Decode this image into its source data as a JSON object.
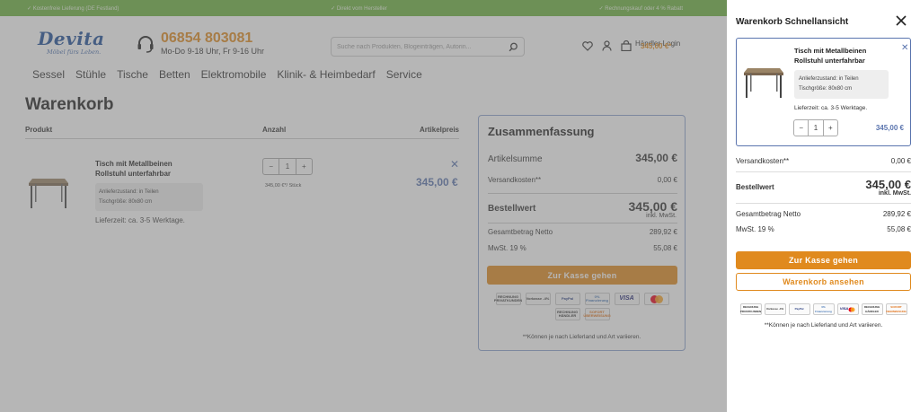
{
  "topbar": {
    "left": "✓ Kostenfreie Lieferung (DE Festland)",
    "center": "✓ Direkt vom Hersteller",
    "right": "✓ Rechnungskauf oder 4 % Rabatt"
  },
  "header": {
    "logo_name": "Devita",
    "logo_slogan": "Möbel fürs Leben.",
    "phone_number": "06854 803081",
    "phone_hours": "Mo-Do 9-18 Uhr, Fr 9-16 Uhr",
    "search_placeholder": "Suche nach Produkten, Blogeinträgen, Autorin...",
    "haendler_login": "Händler-Login",
    "cart_total": "345,00 €*"
  },
  "nav": [
    "Sessel",
    "Stühle",
    "Tische",
    "Betten",
    "Elektromobile",
    "Klinik- & Heimbedarf",
    "Service"
  ],
  "cart": {
    "title": "Warenkorb",
    "col_product": "Produkt",
    "col_qty": "Anzahl",
    "col_price": "Artikelpreis",
    "item": {
      "name": "Tisch mit Metallbeinen Rollstuhl unterfahrbar",
      "attr1": "Anlieferzustand: in Teilen",
      "attr2": "Tischgröße: 80x80 cm",
      "delivery": "Lieferzeit: ca. 3-5 Werktage.",
      "qty_minus": "−",
      "qty": "1",
      "qty_plus": "+",
      "unit_price": "345,00 €*/ Stück",
      "remove": "✕",
      "price": "345,00 €"
    }
  },
  "summary": {
    "title": "Zusammenfassung",
    "subtotal_label": "Artikelsumme",
    "subtotal": "345,00 €",
    "shipping_label": "Versandkosten**",
    "shipping": "0,00 €",
    "total_label": "Bestellwert",
    "total": "345,00 €",
    "total_note": "inkl. MwSt.",
    "net_label": "Gesamtbetrag Netto",
    "net": "289,92 €",
    "vat_label": "MwSt. 19 %",
    "vat": "55,08 €",
    "checkout": "Zur Kasse gehen",
    "note": "**Können je nach Lieferland und Art variieren."
  },
  "payment_logos": [
    "RECHNUNG PRIVATKUNDEN",
    "Vorkasse -4%",
    "PayPal",
    "0% Finanzierung",
    "VISA",
    "Mastercard",
    "RECHNUNG HÄNDLER",
    "SOFORT ÜBERWEISUNG"
  ],
  "offcanvas": {
    "title": "Warenkorb Schnellansicht",
    "close": "✕",
    "item_name": "Tisch mit Metallbeinen Rollstuhl unterfahrbar",
    "attr1": "Anlieferzustand: in Teilen",
    "attr2": "Tischgröße: 80x80 cm",
    "delivery": "Lieferzeit: ca. 3-5 Werktage.",
    "qty_minus": "−",
    "qty": "1",
    "qty_plus": "+",
    "price": "345,00 €",
    "remove": "✕",
    "shipping_label": "Versandkosten**",
    "shipping": "0,00 €",
    "total_label": "Bestellwert",
    "total": "345,00 €",
    "total_note": "inkl. MwSt.",
    "net_label": "Gesamtbetrag Netto",
    "net": "289,92 €",
    "vat_label": "MwSt. 19 %",
    "vat": "55,08 €",
    "checkout": "Zur Kasse gehen",
    "view_cart": "Warenkorb ansehen",
    "note": "**Können je nach Lieferland und Art variieren."
  },
  "colors": {
    "topbar_green": "#6db33f",
    "brand_blue": "#1f4f99",
    "accent_orange": "#e08a1e",
    "price_blue": "#5a74ae"
  }
}
